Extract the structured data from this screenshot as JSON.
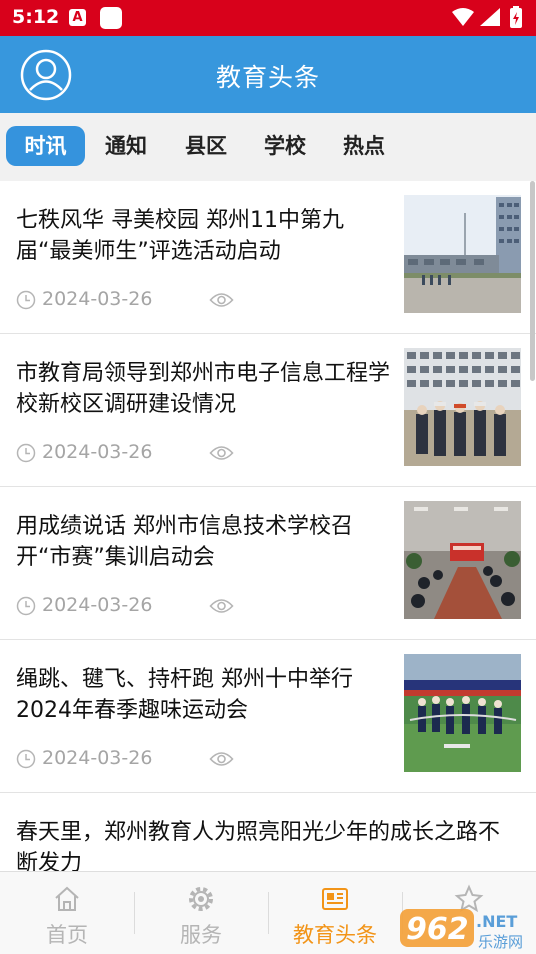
{
  "status_bar": {
    "time": "5:12",
    "a_badge": "A"
  },
  "header": {
    "title": "教育头条"
  },
  "tabs": [
    {
      "label": "时讯",
      "active": true
    },
    {
      "label": "通知",
      "active": false
    },
    {
      "label": "县区",
      "active": false
    },
    {
      "label": "学校",
      "active": false
    },
    {
      "label": "热点",
      "active": false
    }
  ],
  "news": [
    {
      "title": "七秩风华 寻美校园 郑州11中第九届“最美师生”评选活动启动",
      "date": "2024-03-26",
      "thumb": "campus-building-photo"
    },
    {
      "title": "市教育局领导到郑州市电子信息工程学校新校区调研建设情况",
      "date": "2024-03-26",
      "thumb": "construction-site-visit-photo"
    },
    {
      "title": "用成绩说话 郑州市信息技术学校召开“市赛”集训启动会",
      "date": "2024-03-26",
      "thumb": "meeting-room-photo"
    },
    {
      "title": "绳跳、毽飞、持杆跑 郑州十中举行2024年春季趣味运动会",
      "date": "2024-03-26",
      "thumb": "sports-field-photo"
    },
    {
      "title": "春天里，郑州教育人为照亮阳光少年的成长之路不断发力",
      "date": "",
      "thumb": ""
    }
  ],
  "bottom_nav": [
    {
      "label": "首页",
      "icon": "home-icon",
      "active": false
    },
    {
      "label": "服务",
      "icon": "gear-icon",
      "active": false
    },
    {
      "label": "教育头条",
      "icon": "newspaper-icon",
      "active": true
    },
    {
      "label": "",
      "icon": "star-icon",
      "active": false
    }
  ],
  "watermark": {
    "brand": "962",
    "suffix": ".NET",
    "sub": "乐游网"
  },
  "colors": {
    "status_bar": "#d8011b",
    "header": "#3797dd",
    "active_tab": "#3593dd",
    "nav_active": "#f29418",
    "nav_inactive": "#b5b5b5"
  }
}
